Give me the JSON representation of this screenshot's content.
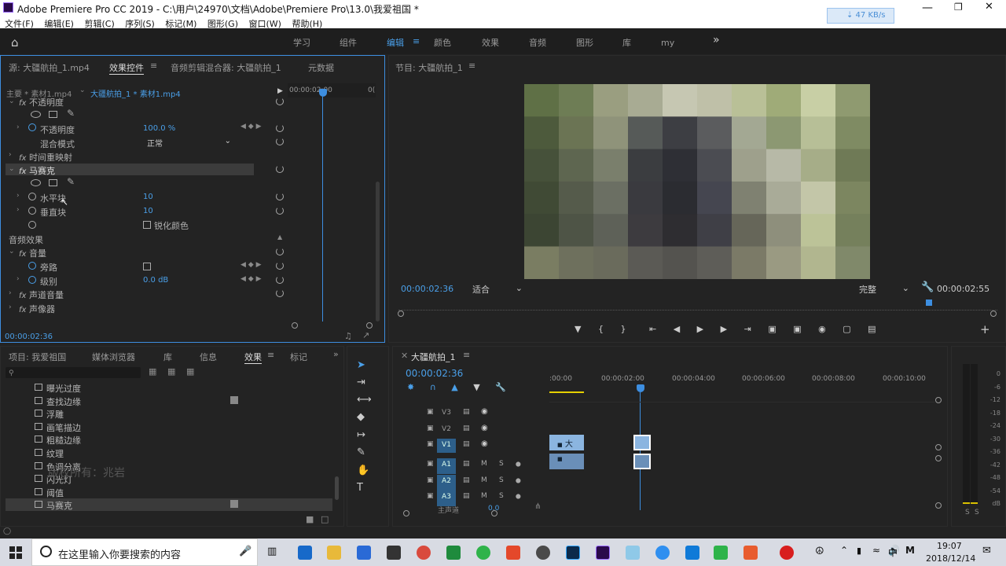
{
  "app": {
    "title": "Adobe Premiere Pro CC 2019 - C:\\用户\\24970\\文档\\Adobe\\Premiere Pro\\13.0\\我爱祖国 *",
    "net_speed": "⇣ 47 KB/s"
  },
  "menu": [
    "文件(F)",
    "编辑(E)",
    "剪辑(C)",
    "序列(S)",
    "标记(M)",
    "图形(G)",
    "窗口(W)",
    "帮助(H)"
  ],
  "workspace": {
    "tabs": [
      "学习",
      "组件",
      "编辑",
      "颜色",
      "效果",
      "音频",
      "图形",
      "库",
      "my"
    ],
    "active": "编辑",
    "more": "»"
  },
  "source_panel": {
    "tabs": [
      "源: 大疆航拍_1.mp4",
      "效果控件",
      "音频剪辑混合器: 大疆航拍_1",
      "元数据"
    ],
    "active": "效果控件",
    "clip_path_master": "主要 * 素材1.mp4",
    "clip_path_seq": "大疆航拍_1 * 素材1.mp4",
    "ruler_time": "00:00:02:00",
    "ruler_end": "0(",
    "rows": {
      "opacity_header": "不透明度",
      "opacity_label": "不透明度",
      "opacity_value": "100.0 %",
      "blend_label": "混合模式",
      "blend_value": "正常",
      "time_remap": "时间重映射",
      "mosaic": "马赛克",
      "h_blocks_label": "水平块",
      "h_blocks_value": "10",
      "v_blocks_label": "垂直块",
      "v_blocks_value": "10",
      "sharpen_label": "锐化颜色",
      "audio_effects": "音频效果",
      "volume": "音量",
      "bypass": "旁路",
      "level_label": "级别",
      "level_value": "0.0 dB",
      "channel_volume": "声道音量",
      "panner": "声像器"
    },
    "timecode": "00:00:02:36"
  },
  "program": {
    "title": "节目: 大疆航拍_1",
    "timecode": "00:00:02:36",
    "fit": "适合",
    "quality": "完整",
    "duration": "00:00:02:55"
  },
  "project_panel": {
    "tabs": [
      "项目: 我爱祖国",
      "媒体浏览器",
      "库",
      "信息",
      "效果",
      "标记"
    ],
    "active": "效果",
    "items": [
      "曝光过度",
      "查找边缘",
      "浮雕",
      "画笔描边",
      "粗糙边缘",
      "纹理",
      "色调分离",
      "闪光灯",
      "阈值",
      "马赛克"
    ],
    "watermark": "版权所有：兆岩"
  },
  "timeline": {
    "title": "大疆航拍_1",
    "timecode": "00:00:02:36",
    "ruler": [
      ":00:00",
      "00:00:02:00",
      "00:00:04:00",
      "00:00:06:00",
      "00:00:08:00",
      "00:00:10:00"
    ],
    "tracks": [
      "V3",
      "V2",
      "V1",
      "A1",
      "A2",
      "A3"
    ],
    "clip_label": "大",
    "master_label": "主声道",
    "master_value": "0.0"
  },
  "meter": {
    "labels": [
      "0",
      "-6",
      "-12",
      "-18",
      "-24",
      "-30",
      "-36",
      "-42",
      "-48",
      "-54",
      "dB"
    ],
    "solo": [
      "S",
      "S"
    ]
  },
  "taskbar": {
    "search_placeholder": "在这里输入你要搜索的内容",
    "time": "19:07",
    "date": "2018/12/14",
    "lang": "中"
  },
  "colors": {
    "accent_blue": "#4a9fe8",
    "playhead": "#3d8ee0",
    "panel_bg": "#232323",
    "clip_video": "#8bb5e0",
    "clip_audio": "#6a8fb8"
  }
}
